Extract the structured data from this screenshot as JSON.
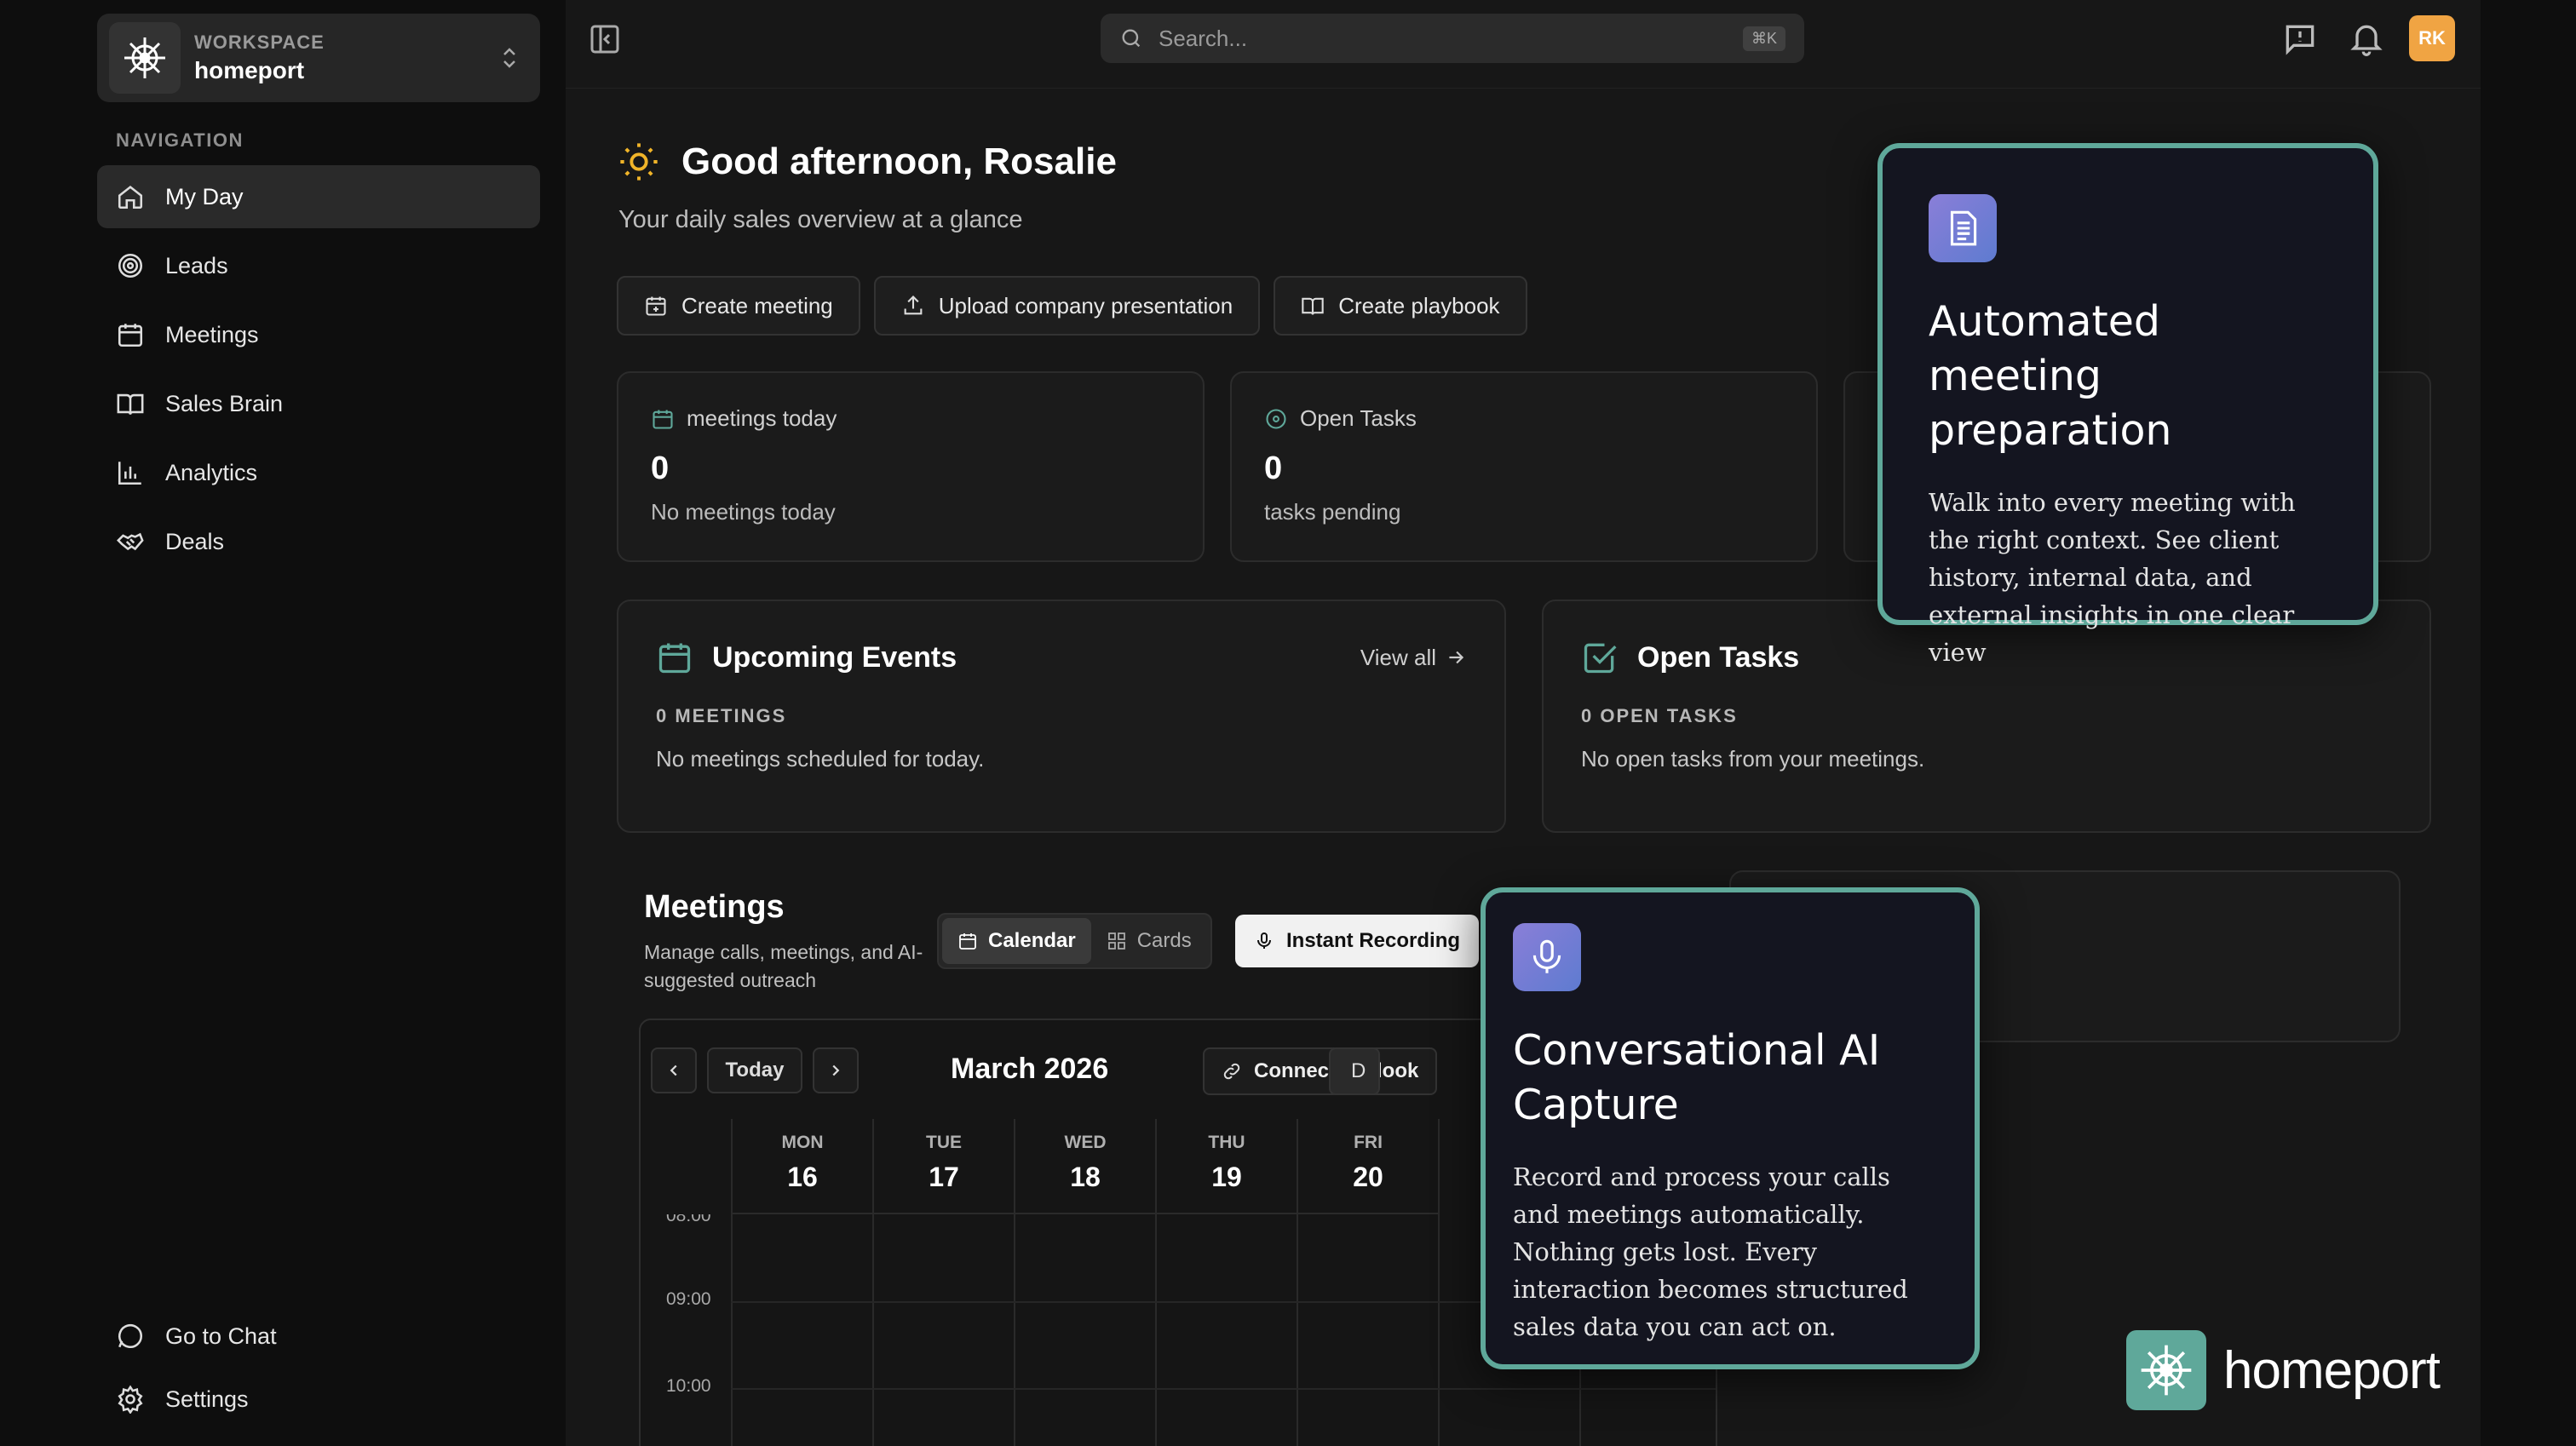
{
  "workspace": {
    "label": "WORKSPACE",
    "name": "homeport"
  },
  "sidebar": {
    "heading": "NAVIGATION",
    "items": [
      {
        "label": "My Day",
        "icon": "home-icon",
        "active": true
      },
      {
        "label": "Leads",
        "icon": "target-icon"
      },
      {
        "label": "Meetings",
        "icon": "calendar-icon"
      },
      {
        "label": "Sales Brain",
        "icon": "book-icon"
      },
      {
        "label": "Analytics",
        "icon": "bar-chart-icon"
      },
      {
        "label": "Deals",
        "icon": "handshake-icon"
      }
    ],
    "bottom": [
      {
        "label": "Go to Chat",
        "icon": "chat-icon"
      },
      {
        "label": "Settings",
        "icon": "gear-icon"
      }
    ]
  },
  "topbar": {
    "search_placeholder": "Search...",
    "shortcut": "⌘K",
    "avatar_initials": "RK"
  },
  "greeting": {
    "title": "Good afternoon, Rosalie",
    "subtitle": "Your daily sales overview at a glance"
  },
  "actions": [
    "Create meeting",
    "Upload company presentation",
    "Create playbook"
  ],
  "stats": [
    {
      "label": "meetings today",
      "value": "0",
      "sub": "No meetings today"
    },
    {
      "label": "Open Tasks",
      "value": "0",
      "sub": "tasks pending"
    }
  ],
  "upcoming": {
    "title": "Upcoming Events",
    "view_all": "View all",
    "count": "0 MEETINGS",
    "empty": "No meetings scheduled for today."
  },
  "tasks": {
    "title": "Open Tasks",
    "count": "0 OPEN TASKS",
    "empty": "No open tasks from your meetings."
  },
  "meetings": {
    "title": "Meetings",
    "description": "Manage calls, meetings, and AI-suggested outreach",
    "view_calendar": "Calendar",
    "view_cards": "Cards",
    "instant_recording": "Instant Recording"
  },
  "calendar": {
    "today": "Today",
    "month": "March 2026",
    "connect": "Connect Outlook",
    "clipped_button": "D",
    "days": [
      {
        "name": "MON",
        "num": "16"
      },
      {
        "name": "TUE",
        "num": "17"
      },
      {
        "name": "WED",
        "num": "18"
      },
      {
        "name": "THU",
        "num": "19"
      },
      {
        "name": "FRI",
        "num": "20"
      }
    ],
    "hours": [
      "08:00",
      "09:00",
      "10:00"
    ]
  },
  "callouts": [
    {
      "title": "Automated meeting preparation",
      "body": "Walk into every meeting with the right context. See client history, internal data, and external insights in one clear view",
      "icon": "document-icon"
    },
    {
      "title": "Conversational AI Capture",
      "body": "Record and process your calls and meetings automatically. Nothing gets lost. Every interaction becomes structured sales data you can act on.",
      "icon": "microphone-icon"
    }
  ],
  "brand": {
    "name": "homeport"
  },
  "colors": {
    "accent": "#5fa89a",
    "avatar": "#f0a443",
    "callout_bg": "#141520",
    "icon_gradient": "#8a7ed8"
  }
}
